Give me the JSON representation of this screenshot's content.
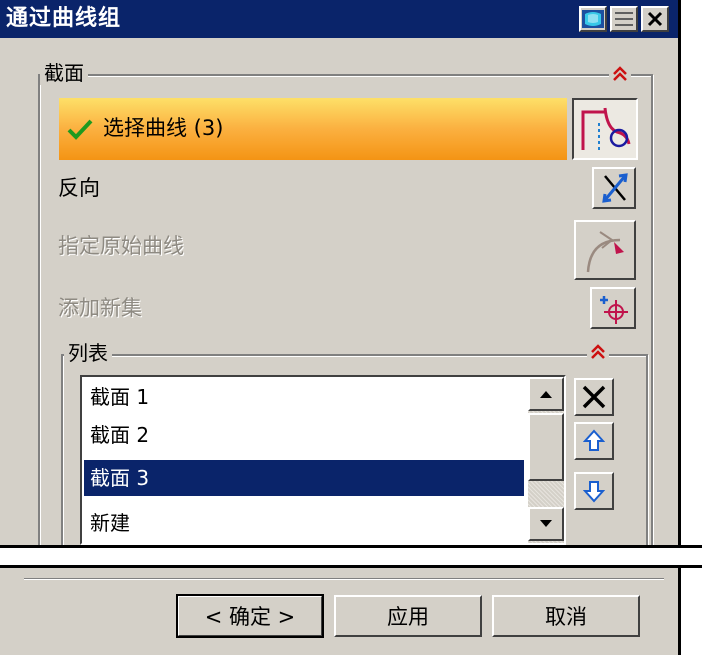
{
  "window": {
    "title": "通过曲线组"
  },
  "section": {
    "legend": "截面",
    "select_curve": {
      "label": "选择曲线 (3)"
    },
    "reverse": {
      "label": "反向"
    },
    "specify_origin": {
      "label": "指定原始曲线"
    },
    "add_new_set": {
      "label": "添加新集"
    }
  },
  "list_group": {
    "legend": "列表",
    "items": [
      {
        "label": "截面 1",
        "selected": false
      },
      {
        "label": "截面 2",
        "selected": false
      },
      {
        "label": "截面 3",
        "selected": true
      },
      {
        "label": "新建",
        "selected": false
      }
    ]
  },
  "footer": {
    "ok_label": "< 确定 >",
    "apply_label": "应用",
    "cancel_label": "取消"
  },
  "icons": {
    "title_reset": "reset-icon",
    "title_menu": "menu-icon",
    "title_close": "close-icon",
    "collapse": "double-chevron-up-icon",
    "check": "checkmark-icon",
    "curve_select": "curve-select-icon",
    "reverse": "reverse-direction-icon",
    "origin_curve": "origin-curve-icon",
    "add_set": "add-set-icon",
    "remove": "remove-icon",
    "move_up": "move-up-icon",
    "move_down": "move-down-icon"
  },
  "colors": {
    "title_bar": "#0a246a",
    "dialog_bg": "#d4d0c8",
    "highlight_row_top": "#fde068",
    "highlight_row_bottom": "#f49414",
    "selection": "#0a246a",
    "accent_red": "#cc1010",
    "arrow_blue": "#1a5fcf"
  }
}
